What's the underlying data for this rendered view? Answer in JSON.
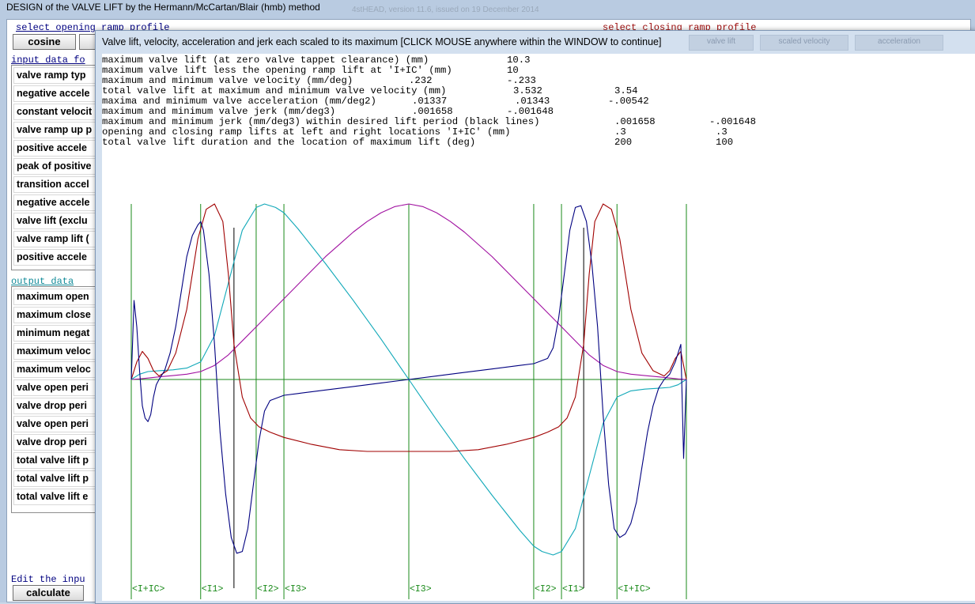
{
  "main_window": {
    "title": "DESIGN of the VALVE LIFT by the Hermann/McCartan/Blair (hmb) method",
    "title_ghost": "4stHEAD, version 11.6, issued on 19 December 2014",
    "opening_profile_label": "select opening ramp profile",
    "closing_profile_label": "select closing ramp profile",
    "opening_profile_button": "cosine",
    "input_data_label": "input data fo",
    "input_rows": [
      "valve ramp typ",
      "negative accele",
      "constant velocit",
      "valve ramp up p",
      "positive accele",
      "peak of positive",
      "transition accel",
      "negative accele",
      "valve lift (exclu",
      "valve ramp lift (",
      "positive accele"
    ],
    "output_data_label": "output data",
    "output_rows": [
      "maximum open",
      "maximum close",
      "minimum negat",
      "maximum veloc",
      "maximum veloc",
      "valve open peri",
      "valve drop peri",
      "valve open peri",
      "valve drop peri",
      "total valve lift p",
      "total valve lift p",
      "total valve lift e"
    ],
    "edit_hint": "Edit the inpu",
    "calculate_button": "calculate"
  },
  "popup": {
    "title": "Valve lift, velocity, acceleration and jerk each scaled to its maximum  [CLICK MOUSE anywhere within the WINDOW to continue]",
    "ghost_buttons": [
      "valve lift",
      "scaled velocity",
      "acceleration"
    ],
    "report": [
      {
        "label": "maximum valve lift (at zero valve tappet clearance) (mm)",
        "values": [
          "10.3"
        ]
      },
      {
        "label": "maximum valve lift less the opening ramp lift at 'I+IC' (mm)",
        "values": [
          "10"
        ]
      },
      {
        "label": "maximum and minimum valve velocity (mm/deg)",
        "values": [
          ".232",
          "-.233"
        ]
      },
      {
        "label": "total valve lift at maximum and minimum valve velocity (mm)",
        "values": [
          "3.532",
          "3.54"
        ]
      },
      {
        "label": "maxima and minimum valve acceleration (mm/deg2)",
        "values": [
          ".01337",
          ".01343",
          "-.00542"
        ]
      },
      {
        "label": "maximum and minimum valve jerk (mm/deg3)",
        "values": [
          ".001658",
          "-.001648"
        ]
      },
      {
        "label": "maximum and minimum jerk (mm/deg3) within desired lift period (black lines)",
        "values": [
          ".001658",
          "-.001648"
        ]
      },
      {
        "label": "opening and closing ramp lifts at left and right locations 'I+IC' (mm)",
        "values": [
          ".3",
          ".3"
        ]
      },
      {
        "label": "total valve lift duration and the location of maximum lift (deg)",
        "values": [
          "200",
          "100"
        ]
      }
    ],
    "period_markers": [
      "<I+IC>",
      "<I1>",
      "<I2>",
      "<I3>",
      "<I3>",
      "<I2>",
      "<I1>",
      "<I+IC>"
    ]
  },
  "chart_data": {
    "type": "line",
    "title": "",
    "xlabel": "",
    "ylabel": "",
    "xlim": [
      0,
      200
    ],
    "ylim": [
      -1,
      1
    ],
    "grid": false,
    "legend": "none",
    "colors": {
      "lift": "#a010a0",
      "velocity": "#10a8b8",
      "acceleration": "#a00000",
      "jerk": "#000080",
      "period_lines": "#1a8a1a",
      "axis": "#1a8a1a",
      "limit_lines": "#000000"
    },
    "period_x": [
      0,
      25,
      45,
      55,
      100,
      145,
      155,
      175,
      200
    ],
    "black_lines_x": [
      37,
      163
    ],
    "series": [
      {
        "key": "lift",
        "x": [
          0,
          3,
          7,
          10,
          15,
          20,
          25,
          30,
          35,
          40,
          45,
          50,
          55,
          60,
          65,
          70,
          75,
          80,
          85,
          90,
          95,
          100,
          105,
          110,
          115,
          120,
          125,
          130,
          135,
          140,
          145,
          150,
          155,
          160,
          165,
          170,
          175,
          180,
          185,
          190,
          193,
          197,
          200
        ],
        "y": [
          0,
          0.003,
          0.01,
          0.015,
          0.022,
          0.03,
          0.045,
          0.08,
          0.14,
          0.22,
          0.3,
          0.38,
          0.46,
          0.54,
          0.62,
          0.7,
          0.77,
          0.84,
          0.9,
          0.95,
          0.985,
          1,
          0.985,
          0.95,
          0.9,
          0.84,
          0.77,
          0.7,
          0.62,
          0.54,
          0.46,
          0.38,
          0.3,
          0.22,
          0.14,
          0.08,
          0.045,
          0.03,
          0.022,
          0.015,
          0.01,
          0.003,
          0
        ]
      },
      {
        "key": "velocity",
        "x": [
          0,
          3,
          6,
          10,
          15,
          20,
          25,
          30,
          35,
          40,
          45,
          48,
          52,
          55,
          60,
          70,
          80,
          90,
          100,
          110,
          120,
          130,
          140,
          145,
          148,
          152,
          155,
          160,
          165,
          170,
          175,
          180,
          185,
          190,
          194,
          197,
          200
        ],
        "y": [
          0,
          0.03,
          0.045,
          0.05,
          0.055,
          0.065,
          0.1,
          0.25,
          0.55,
          0.85,
          0.98,
          1,
          0.98,
          0.95,
          0.86,
          0.66,
          0.45,
          0.23,
          0,
          -0.23,
          -0.45,
          -0.66,
          -0.86,
          -0.95,
          -0.98,
          -1,
          -0.98,
          -0.85,
          -0.55,
          -0.25,
          -0.1,
          -0.065,
          -0.055,
          -0.05,
          -0.045,
          -0.03,
          0
        ]
      },
      {
        "key": "acceleration",
        "x": [
          0,
          2,
          4,
          6,
          8,
          10,
          13,
          16,
          20,
          24,
          27,
          30,
          33,
          35,
          37,
          40,
          43,
          46,
          50,
          55,
          65,
          75,
          85,
          95,
          100,
          105,
          115,
          125,
          135,
          145,
          150,
          154,
          157,
          160,
          163,
          165,
          167,
          170,
          173,
          176,
          180,
          184,
          188,
          192,
          194,
          196,
          198,
          200
        ],
        "y": [
          0,
          0.1,
          0.16,
          0.12,
          0.05,
          0.02,
          0.05,
          0.15,
          0.4,
          0.8,
          0.97,
          1,
          0.9,
          0.6,
          0.2,
          -0.1,
          -0.22,
          -0.27,
          -0.3,
          -0.33,
          -0.37,
          -0.4,
          -0.41,
          -0.41,
          -0.41,
          -0.41,
          -0.41,
          -0.4,
          -0.37,
          -0.33,
          -0.3,
          -0.27,
          -0.22,
          -0.1,
          0.2,
          0.6,
          0.9,
          1,
          0.97,
          0.8,
          0.4,
          0.15,
          0.05,
          0.02,
          0.05,
          0.12,
          0.16,
          0
        ]
      },
      {
        "key": "jerk",
        "x": [
          0,
          1,
          2,
          3,
          4,
          5,
          6,
          7,
          8,
          9,
          10,
          12,
          14,
          16,
          18,
          20,
          22,
          24,
          25,
          26,
          28,
          30,
          32,
          34,
          36,
          38,
          40,
          42,
          44,
          46,
          48,
          50,
          55,
          60,
          70,
          80,
          90,
          100,
          110,
          120,
          130,
          140,
          145,
          150,
          152,
          154,
          156,
          158,
          160,
          162,
          164,
          166,
          168,
          170,
          172,
          174,
          176,
          178,
          180,
          182,
          184,
          186,
          188,
          190,
          192,
          194,
          196,
          198,
          199,
          200
        ],
        "y": [
          0,
          0.45,
          0.3,
          0.05,
          -0.15,
          -0.22,
          -0.24,
          -0.2,
          -0.1,
          -0.03,
          0,
          0.05,
          0.15,
          0.3,
          0.5,
          0.7,
          0.82,
          0.88,
          0.9,
          0.85,
          0.6,
          0.2,
          -0.3,
          -0.65,
          -0.9,
          -0.99,
          -0.98,
          -0.85,
          -0.6,
          -0.35,
          -0.18,
          -0.12,
          -0.09,
          -0.08,
          -0.06,
          -0.04,
          -0.02,
          0,
          0.02,
          0.04,
          0.06,
          0.08,
          0.09,
          0.12,
          0.18,
          0.35,
          0.6,
          0.85,
          0.98,
          0.99,
          0.9,
          0.65,
          0.3,
          -0.2,
          -0.6,
          -0.85,
          -0.9,
          -0.88,
          -0.82,
          -0.7,
          -0.5,
          -0.3,
          -0.15,
          -0.05,
          0,
          0.03,
          0.1,
          0.2,
          -0.45,
          0
        ]
      }
    ]
  }
}
